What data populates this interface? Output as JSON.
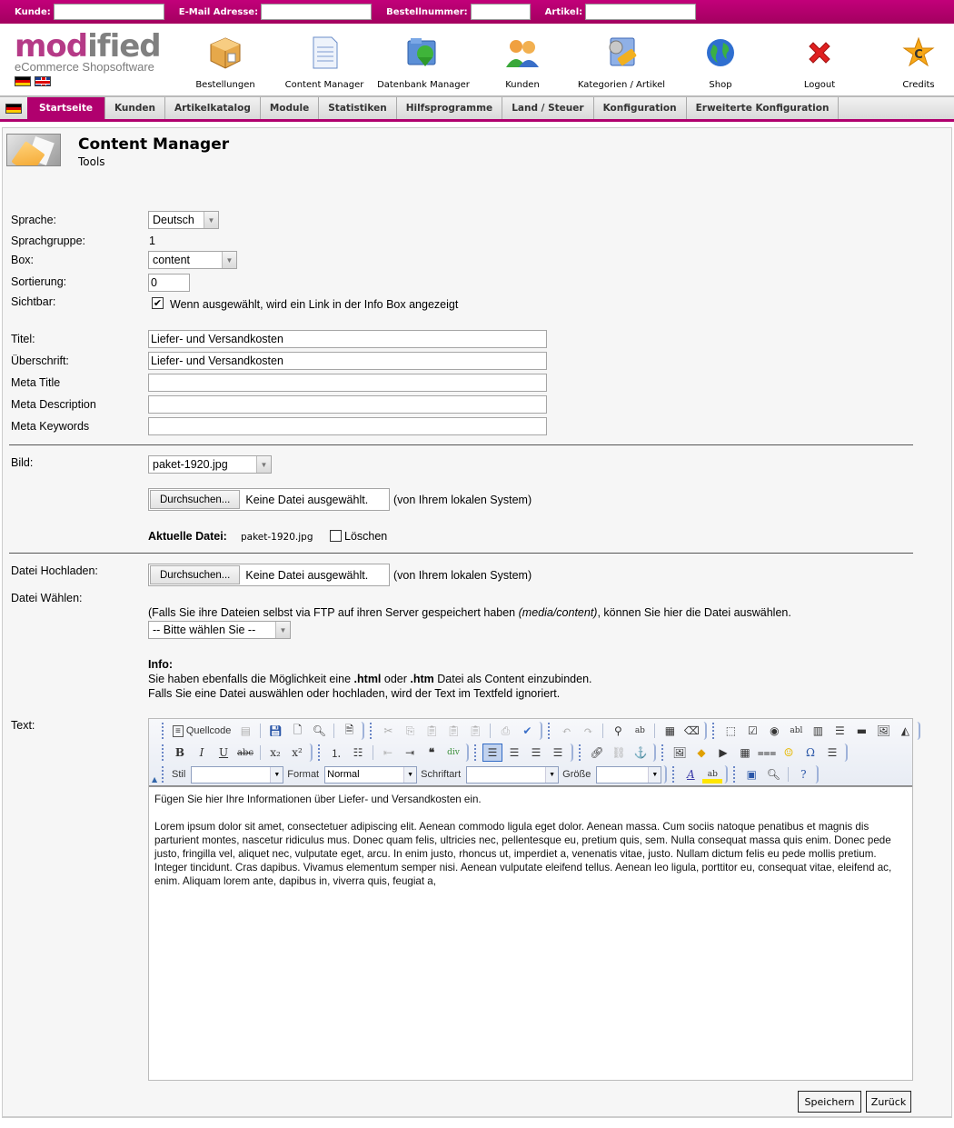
{
  "searchbar": {
    "fields": [
      {
        "label": "Kunde:",
        "value": ""
      },
      {
        "label": "E-Mail Adresse:",
        "value": ""
      },
      {
        "label": "Bestellnummer:",
        "value": ""
      },
      {
        "label": "Artikel:",
        "value": ""
      }
    ]
  },
  "logo": {
    "part1": "mod",
    "part2": "ified",
    "tagline": "eCommerce Shopsoftware"
  },
  "languages": [
    {
      "icon": "flag-de-icon",
      "name": "Deutsch"
    },
    {
      "icon": "flag-en-icon",
      "name": "English"
    }
  ],
  "nav_icons": [
    {
      "label": "Bestellungen",
      "icon": "package-icon"
    },
    {
      "label": "Content Manager",
      "icon": "document-icon"
    },
    {
      "label": "Datenbank Manager",
      "icon": "database-folder-icon"
    },
    {
      "label": "Kunden",
      "icon": "users-icon"
    },
    {
      "label": "Kategorien / Artikel",
      "icon": "tools-icon"
    },
    {
      "label": "Shop",
      "icon": "globe-icon"
    },
    {
      "label": "Logout",
      "icon": "close-x-icon"
    },
    {
      "label": "Credits",
      "icon": "star-c-icon"
    }
  ],
  "tabs": [
    {
      "label": "Startseite",
      "active": true
    },
    {
      "label": "Kunden"
    },
    {
      "label": "Artikelkatalog"
    },
    {
      "label": "Module"
    },
    {
      "label": "Statistiken"
    },
    {
      "label": "Hilfsprogramme"
    },
    {
      "label": "Land / Steuer"
    },
    {
      "label": "Konfiguration"
    },
    {
      "label": "Erweiterte Konfiguration"
    }
  ],
  "page": {
    "title": "Content Manager",
    "subtitle": "Tools"
  },
  "form": {
    "sprache": {
      "label": "Sprache:",
      "value": "Deutsch"
    },
    "sprachgruppe": {
      "label": "Sprachgruppe:",
      "value": "1"
    },
    "box": {
      "label": "Box:",
      "value": "content"
    },
    "sortierung": {
      "label": "Sortierung:",
      "value": "0"
    },
    "sichtbar": {
      "label": "Sichtbar:",
      "checked": true,
      "checkmark": "✔",
      "text": "Wenn ausgewählt, wird ein Link in der Info Box angezeigt"
    },
    "titel": {
      "label": "Titel:",
      "value": "Liefer- und Versandkosten"
    },
    "ueberschrift": {
      "label": "Überschrift:",
      "value": "Liefer- und Versandkosten"
    },
    "meta_title": {
      "label": "Meta Title",
      "value": ""
    },
    "meta_description": {
      "label": "Meta Description",
      "value": ""
    },
    "meta_keywords": {
      "label": "Meta Keywords",
      "value": ""
    },
    "bild": {
      "label": "Bild:",
      "value": "paket-1920.jpg",
      "browse_label": "Durchsuchen...",
      "no_file": "Keine Datei ausgewählt.",
      "hint": "(von Ihrem lokalen System)",
      "current_label": "Aktuelle Datei:",
      "current_file": "paket-1920.jpg",
      "delete_label": "Löschen",
      "delete_checked": false
    },
    "datei_hochladen": {
      "label": "Datei Hochladen:",
      "browse_label": "Durchsuchen...",
      "no_file": "Keine Datei ausgewählt.",
      "hint": "(von Ihrem lokalen System)"
    },
    "datei_waehlen": {
      "label": "Datei Wählen:",
      "hint_before": "(Falls Sie ihre Dateien selbst via FTP auf ihren Server gespeichert haben ",
      "hint_path": "(media/content)",
      "hint_after": ", können Sie hier die Datei auswählen.",
      "value": "-- Bitte wählen Sie --"
    },
    "info": {
      "title": "Info:",
      "line1_a": "Sie haben ebenfalls die Möglichkeit eine ",
      "line1_b": ".html",
      "line1_c": " oder ",
      "line1_d": ".htm",
      "line1_e": " Datei als Content einzubinden.",
      "line2": "Falls Sie eine Datei auswählen oder hochladen, wird der Text im Textfeld ignoriert."
    },
    "text": {
      "label": "Text:"
    }
  },
  "editor": {
    "source_label": "Quellcode",
    "stil_label": "Stil",
    "stil_value": "",
    "format_label": "Format",
    "format_value": "Normal",
    "schriftart_label": "Schriftart",
    "schriftart_value": "",
    "groesse_label": "Größe",
    "groesse_value": "",
    "content": {
      "p1": "Fügen Sie hier Ihre Informationen über Liefer- und Versandkosten ein.",
      "p2": "Lorem ipsum dolor sit amet, consectetuer adipiscing elit. Aenean commodo ligula eget dolor. Aenean massa. Cum sociis natoque penatibus et magnis dis parturient montes, nascetur ridiculus mus. Donec quam felis, ultricies nec, pellentesque eu, pretium quis, sem. Nulla consequat massa quis enim. Donec pede justo, fringilla vel, aliquet nec, vulputate eget, arcu. In enim justo, rhoncus ut, imperdiet a, venenatis vitae, justo. Nullam dictum felis eu pede mollis pretium. Integer tincidunt. Cras dapibus. Vivamus elementum semper nisi. Aenean vulputate eleifend tellus. Aenean leo ligula, porttitor eu, consequat vitae, eleifend ac, enim. Aliquam lorem ante, dapibus in, viverra quis, feugiat a,"
    }
  },
  "buttons": {
    "save": "Speichern",
    "back": "Zurück"
  },
  "colors": {
    "brand": "#b0006e",
    "searchbar_top": "#c2007a",
    "logo_pink": "#b53a87",
    "logo_gray": "#808080"
  }
}
